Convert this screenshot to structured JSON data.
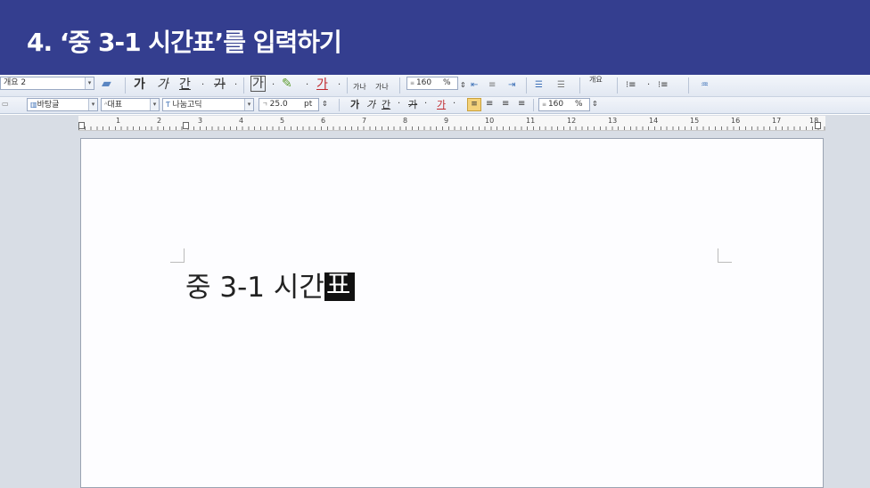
{
  "banner": {
    "title": "4. ‘중 3-1 시간표’를 입력하기"
  },
  "toolbar1": {
    "style_combo": "개요 2",
    "bold_glyph": "가",
    "italic_glyph": "가",
    "underline_glyph": "간",
    "strike_glyph": "가",
    "char_box_glyph": "가",
    "font_color_glyph": "가",
    "width_wide": "가나",
    "width_narrow": "가나",
    "line_spacing_value": "160",
    "line_spacing_unit": "%",
    "outline_label": "개요"
  },
  "toolbar2": {
    "style_combo": "바탕글",
    "shape_combo": "대표",
    "font_combo": "나눔고딕",
    "size_value": "25.0",
    "size_unit": "pt",
    "bold_glyph": "가",
    "italic_glyph": "가",
    "underline_glyph": "간",
    "strike_glyph": "가",
    "font_color_glyph": "가",
    "line_spacing_value": "160",
    "line_spacing_unit": "%"
  },
  "ruler": {
    "labels": [
      "1",
      "2",
      "3",
      "4",
      "5",
      "6",
      "7",
      "8",
      "9",
      "10",
      "11",
      "12",
      "13",
      "14",
      "15",
      "16",
      "17",
      "18"
    ]
  },
  "document": {
    "typed_text": "중 3-1 시간",
    "composing_char": "표"
  },
  "colors": {
    "banner": "#343e8f",
    "toolbar_bg": "#e6ebf3",
    "page_bg": "#fdfdff",
    "workspace": "#d8dde5"
  }
}
